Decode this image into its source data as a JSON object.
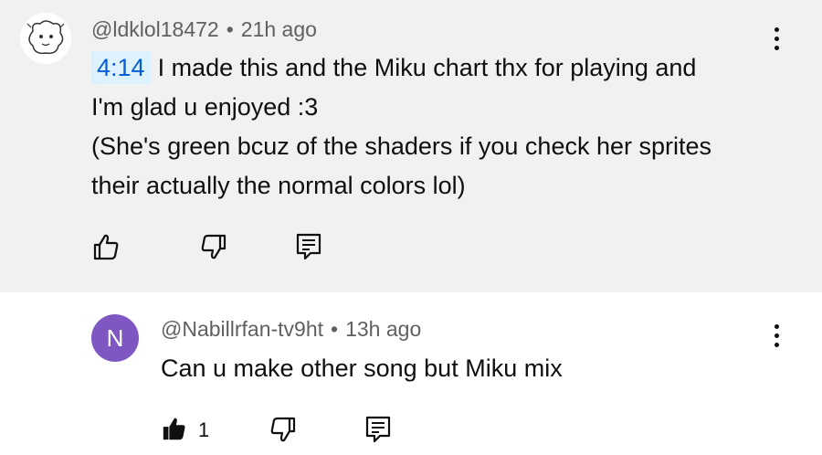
{
  "comments": [
    {
      "author": "@ldklol18472",
      "time": "21h ago",
      "separator": "•",
      "timestamp_link": "4:14",
      "lines": [
        "I made this and the Miku chart thx for playing and",
        "I'm glad u enjoyed :3",
        "(She's green bcuz of the shaders if you check her sprites",
        "their actually the normal colors lol)"
      ],
      "avatar_icon": "sketch-character-avatar",
      "background": "#f1f1f1"
    },
    {
      "author": "@Nabillrfan-tv9ht",
      "time": "13h ago",
      "separator": "•",
      "text": "Can u make other song but Miku mix",
      "avatar_letter": "N",
      "avatar_color": "#7e57c2",
      "like_count": "1"
    }
  ],
  "icons": {
    "like": "thumbs-up-icon",
    "dislike": "thumbs-down-icon",
    "reply": "reply-comment-icon",
    "more": "more-vertical-icon"
  },
  "colors": {
    "link_blue": "#065fd4",
    "timestamp_bg": "#def1ff",
    "meta_gray": "#606060"
  }
}
